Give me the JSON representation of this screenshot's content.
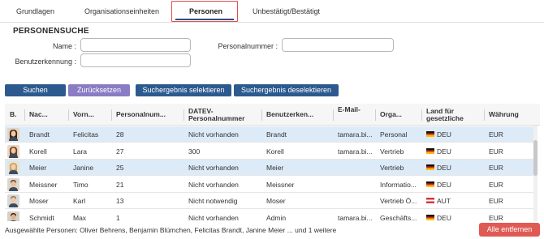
{
  "tabs": [
    {
      "label": "Grundlagen"
    },
    {
      "label": "Organisationseinheiten"
    },
    {
      "label": "Personen"
    },
    {
      "label": "Unbestätigt/Bestätigt"
    }
  ],
  "search": {
    "title": "PERSONENSUCHE",
    "name_label": "Name :",
    "personalnummer_label": "Personalnummer :",
    "benutzerkennung_label": "Benutzerkennung :",
    "name_value": "",
    "personalnummer_value": "",
    "benutzerkennung_value": ""
  },
  "buttons": {
    "suchen": "Suchen",
    "zuruecksetzen": "Zurücksetzen",
    "select_all": "Suchergebnis selektieren",
    "deselect_all": "Suchergebnis deselektieren",
    "remove_all": "Alle entfernen"
  },
  "table": {
    "headers": [
      "B.",
      "Nac...",
      "Vorn...",
      "Personalnum...",
      "DATEV-Personalnummer",
      "Benutzerken...",
      "E-Mail-",
      "Orga...",
      "Land für gesetzliche",
      "Währung"
    ],
    "rows": [
      {
        "nachname": "Brandt",
        "vorname": "Felicitas",
        "personalnummer": "28",
        "datev": "Nicht vorhanden",
        "benutzerkennung": "Brandt",
        "email": "tamara.bi...",
        "orga": "Personal",
        "land": "DEU",
        "flag": "de",
        "waehrung": "EUR",
        "selected": true,
        "avatar": "woman-dark"
      },
      {
        "nachname": "Korell",
        "vorname": "Lara",
        "personalnummer": "27",
        "datev": "300",
        "benutzerkennung": "Korell",
        "email": "tamara.bi...",
        "orga": "Vertrieb",
        "land": "DEU",
        "flag": "de",
        "waehrung": "EUR",
        "selected": false,
        "avatar": "woman-brown"
      },
      {
        "nachname": "Meier",
        "vorname": "Janine",
        "personalnummer": "25",
        "datev": "Nicht vorhanden",
        "benutzerkennung": "Meier",
        "email": "",
        "orga": "Vertrieb",
        "land": "DEU",
        "flag": "de",
        "waehrung": "EUR",
        "selected": true,
        "avatar": "woman-blonde"
      },
      {
        "nachname": "Meissner",
        "vorname": "Timo",
        "personalnummer": "21",
        "datev": "Nicht vorhanden",
        "benutzerkennung": "Meissner",
        "email": "",
        "orga": "Informatio...",
        "land": "DEU",
        "flag": "de",
        "waehrung": "EUR",
        "selected": false,
        "avatar": "man-brown"
      },
      {
        "nachname": "Moser",
        "vorname": "Karl",
        "personalnummer": "13",
        "datev": "Nicht notwendig",
        "benutzerkennung": "Moser",
        "email": "",
        "orga": "Vertrieb Ö...",
        "land": "AUT",
        "flag": "at",
        "waehrung": "EUR",
        "selected": false,
        "avatar": "man-light"
      },
      {
        "nachname": "Schmidt",
        "vorname": "Max",
        "personalnummer": "1",
        "datev": "Nicht vorhanden",
        "benutzerkennung": "Admin",
        "email": "tamara.bi...",
        "orga": "Geschäfts...",
        "land": "DEU",
        "flag": "de",
        "waehrung": "EUR",
        "selected": false,
        "avatar": "man-dark"
      }
    ]
  },
  "footer": {
    "selected_text": "Ausgewählte Personen: Oliver Behrens, Benjamin Blümchen, Felicitas Brandt, Janine Meier ... und 1 weitere"
  },
  "colors": {
    "primary": "#2c5a8f",
    "secondary": "#8a7cc4",
    "danger": "#e05a55",
    "selected_row": "#ddeaf7",
    "tab_highlight": "#e05050"
  }
}
